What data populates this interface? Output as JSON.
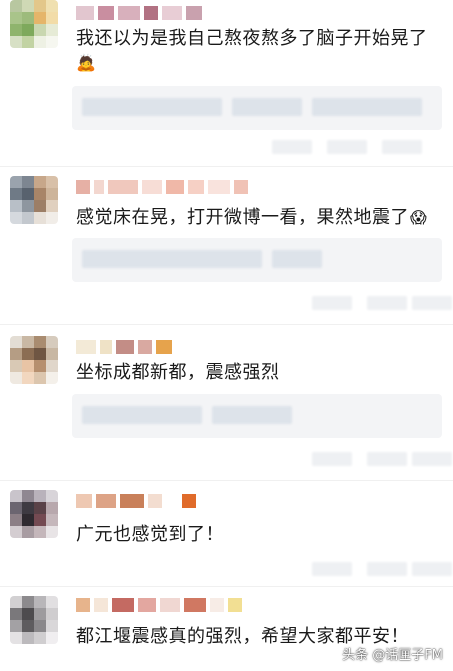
{
  "comments": [
    {
      "text": "我还以为是我自己熬夜熬多了脑子开始晃了",
      "emoji": "🙇"
    },
    {
      "text": "感觉床在晃，打开微博一看，果然地震了",
      "emoji": "😱"
    },
    {
      "text": "坐标成都新都，震感强烈"
    },
    {
      "text": "广元也感觉到了！"
    },
    {
      "text": "都江堰震感真的强烈，希望大家都平安！"
    }
  ],
  "watermark": "头条 @话匣子FM",
  "colors": {
    "background": "#ffffff",
    "text": "#1a1a1a",
    "reply_box": "#f3f4f6"
  }
}
